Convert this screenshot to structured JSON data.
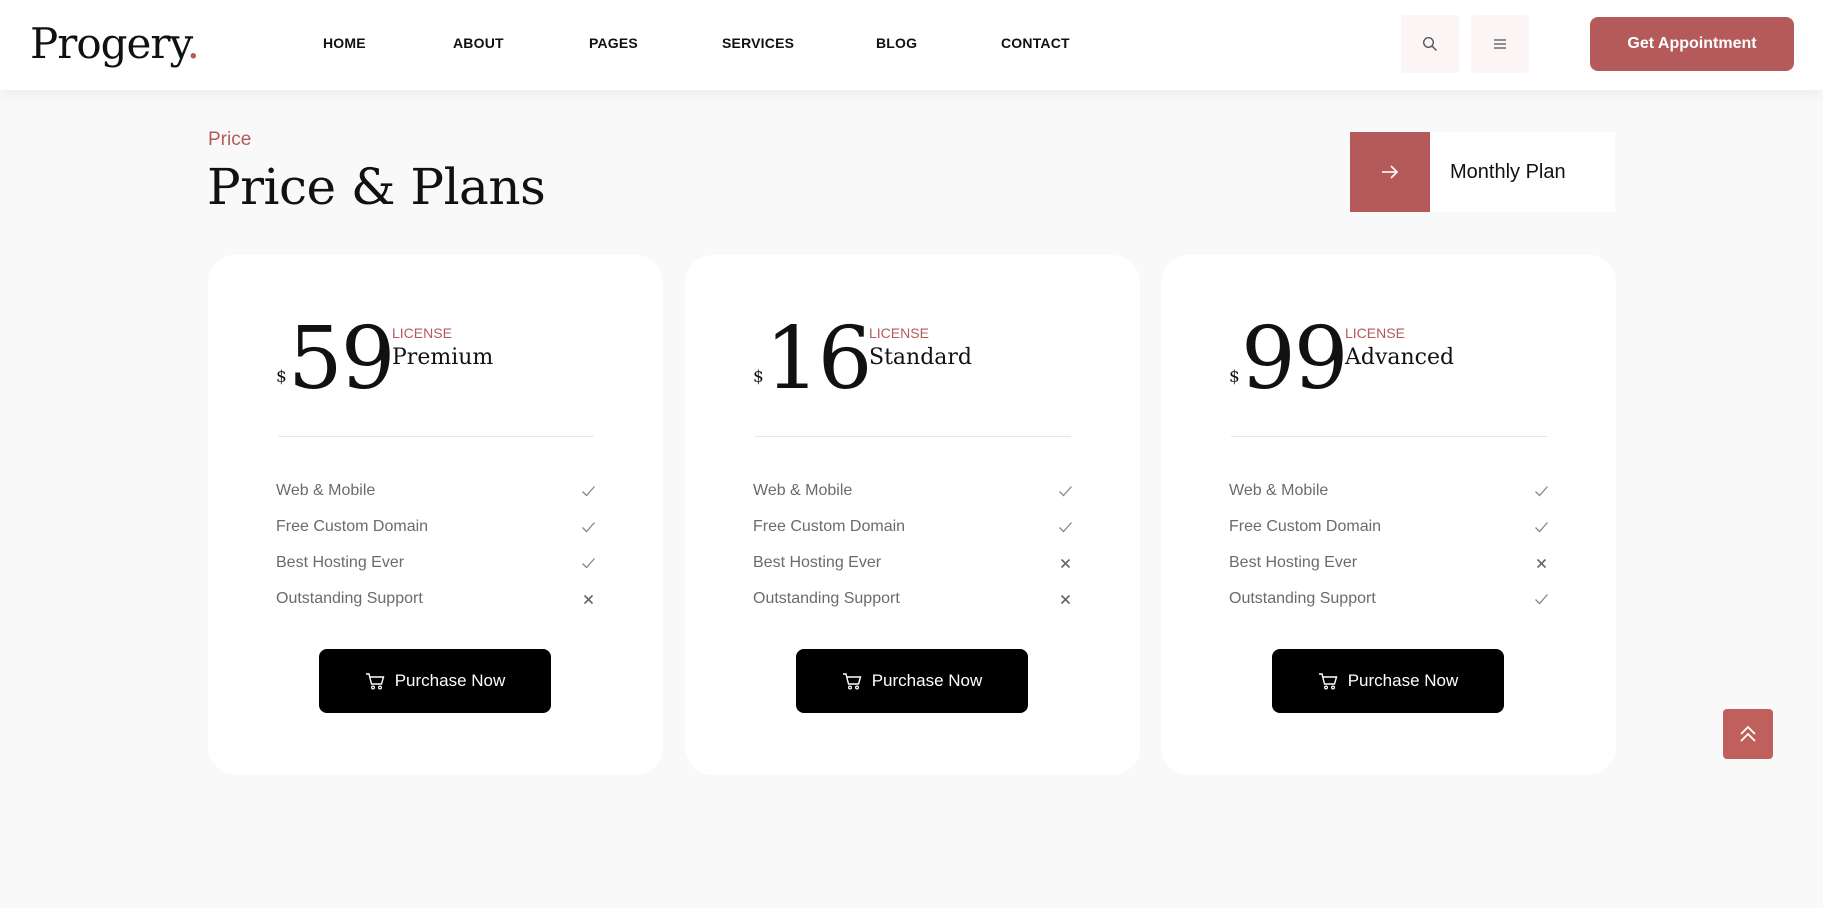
{
  "header": {
    "logo_text": "Progery",
    "logo_dot": ".",
    "nav": [
      "HOME",
      "ABOUT",
      "PAGES",
      "SERVICES",
      "BLOG",
      "CONTACT"
    ],
    "cta_label": "Get Appointment",
    "icons": [
      "search-icon",
      "menu-icon"
    ]
  },
  "section": {
    "eyebrow": "Price",
    "title": "Price & Plans",
    "toggle_label": "Monthly Plan"
  },
  "plans": [
    {
      "currency": "$",
      "amount": "59",
      "license_tag": "LICENSE",
      "license_name": "Premium",
      "features": [
        {
          "label": "Web & Mobile",
          "included": true
        },
        {
          "label": "Free Custom Domain",
          "included": true
        },
        {
          "label": "Best Hosting Ever",
          "included": true
        },
        {
          "label": "Outstanding Support",
          "included": false
        }
      ],
      "button_label": "Purchase Now"
    },
    {
      "currency": "$",
      "amount": "16",
      "license_tag": "LICENSE",
      "license_name": "Standard",
      "features": [
        {
          "label": "Web & Mobile",
          "included": true
        },
        {
          "label": "Free Custom Domain",
          "included": true
        },
        {
          "label": "Best Hosting Ever",
          "included": false
        },
        {
          "label": "Outstanding Support",
          "included": false
        }
      ],
      "button_label": "Purchase Now"
    },
    {
      "currency": "$",
      "amount": "99",
      "license_tag": "LICENSE",
      "license_name": "Advanced",
      "features": [
        {
          "label": "Web & Mobile",
          "included": true
        },
        {
          "label": "Free Custom Domain",
          "included": true
        },
        {
          "label": "Best Hosting Ever",
          "included": false
        },
        {
          "label": "Outstanding Support",
          "included": true
        }
      ],
      "button_label": "Purchase Now"
    }
  ],
  "colors": {
    "accent": "#b45a5a",
    "button": "#000000",
    "muted_text": "#6b6b6b"
  }
}
